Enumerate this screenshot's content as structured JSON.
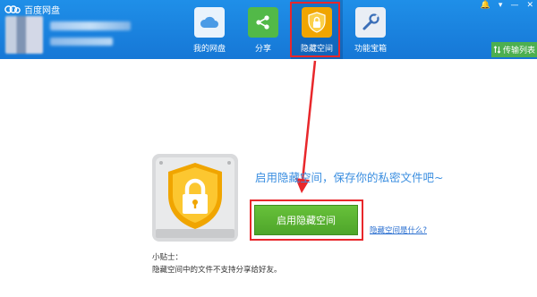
{
  "app": {
    "title": "百度网盘"
  },
  "nav": {
    "items": [
      {
        "label": "我的网盘",
        "icon": "cloud-icon"
      },
      {
        "label": "分享",
        "icon": "share-icon"
      },
      {
        "label": "隐藏空间",
        "icon": "lock-shield-icon"
      },
      {
        "label": "功能宝箱",
        "icon": "toolbox-icon"
      }
    ],
    "active_index": 2
  },
  "window": {
    "controls": [
      {
        "symbol": "🔔",
        "icon": "bell-icon"
      },
      {
        "symbol": "▾",
        "icon": "menu-chevron-icon"
      },
      {
        "symbol": "—",
        "icon": "minimize-icon"
      },
      {
        "symbol": "✕",
        "icon": "close-icon"
      }
    ]
  },
  "transfer": {
    "label": "传输列表",
    "icon": "transfer-arrows-icon"
  },
  "content": {
    "headline": "启用隐藏空间，保存你的私密文件吧~",
    "enable_button": "启用隐藏空间",
    "what_link": "隐藏空间是什么?",
    "tip_title": "小贴士：",
    "tip_text": "隐藏空间中的文件不支持分享给好友。"
  },
  "colors": {
    "header": "#1677d6",
    "highlight": "#e8272b",
    "primary_button": "#57b030",
    "shield": "#f5b800",
    "link": "#2a6fd0"
  }
}
